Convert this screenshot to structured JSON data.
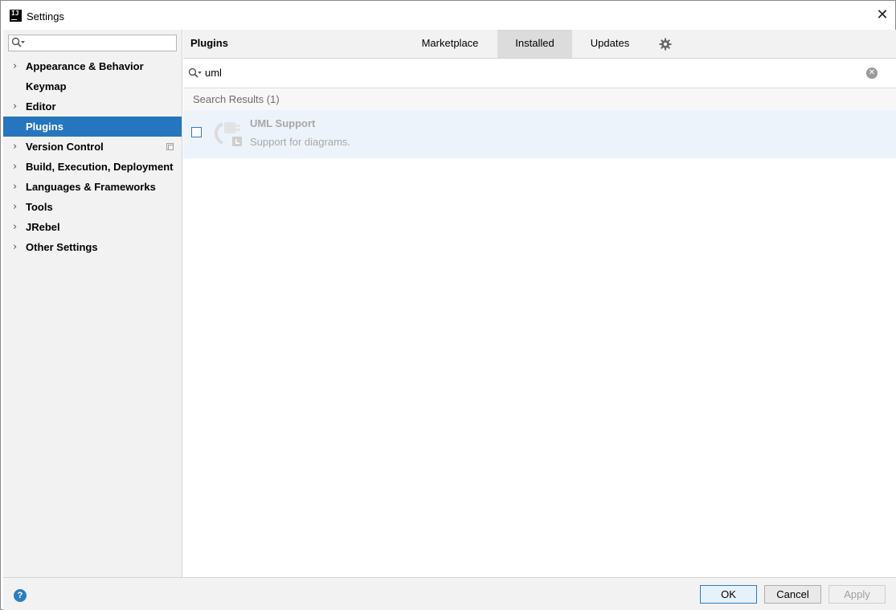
{
  "window": {
    "title": "Settings",
    "app_icon": "intellij-icon",
    "close": "✕"
  },
  "sidebar": {
    "search_value": "",
    "items": [
      {
        "label": "Appearance & Behavior",
        "expandable": true
      },
      {
        "label": "Keymap",
        "expandable": false
      },
      {
        "label": "Editor",
        "expandable": true
      },
      {
        "label": "Plugins",
        "expandable": false,
        "selected": true
      },
      {
        "label": "Version Control",
        "expandable": true,
        "has_copy_icon": true
      },
      {
        "label": "Build, Execution, Deployment",
        "expandable": true
      },
      {
        "label": "Languages & Frameworks",
        "expandable": true
      },
      {
        "label": "Tools",
        "expandable": true
      },
      {
        "label": "JRebel",
        "expandable": true
      },
      {
        "label": "Other Settings",
        "expandable": true
      }
    ],
    "chevron": "›"
  },
  "plugins": {
    "title": "Plugins",
    "tabs": [
      {
        "label": "Marketplace",
        "active": false
      },
      {
        "label": "Installed",
        "active": true
      },
      {
        "label": "Updates",
        "active": false
      }
    ],
    "search_value": "uml",
    "results_label": "Search Results (1)",
    "results": [
      {
        "name": "UML Support",
        "description": "Support for diagrams.",
        "enabled": false
      }
    ]
  },
  "footer": {
    "help": "?",
    "ok": "OK",
    "cancel": "Cancel",
    "apply": "Apply"
  },
  "colors": {
    "selection": "#2675bf",
    "accent": "#2b7ec1"
  }
}
